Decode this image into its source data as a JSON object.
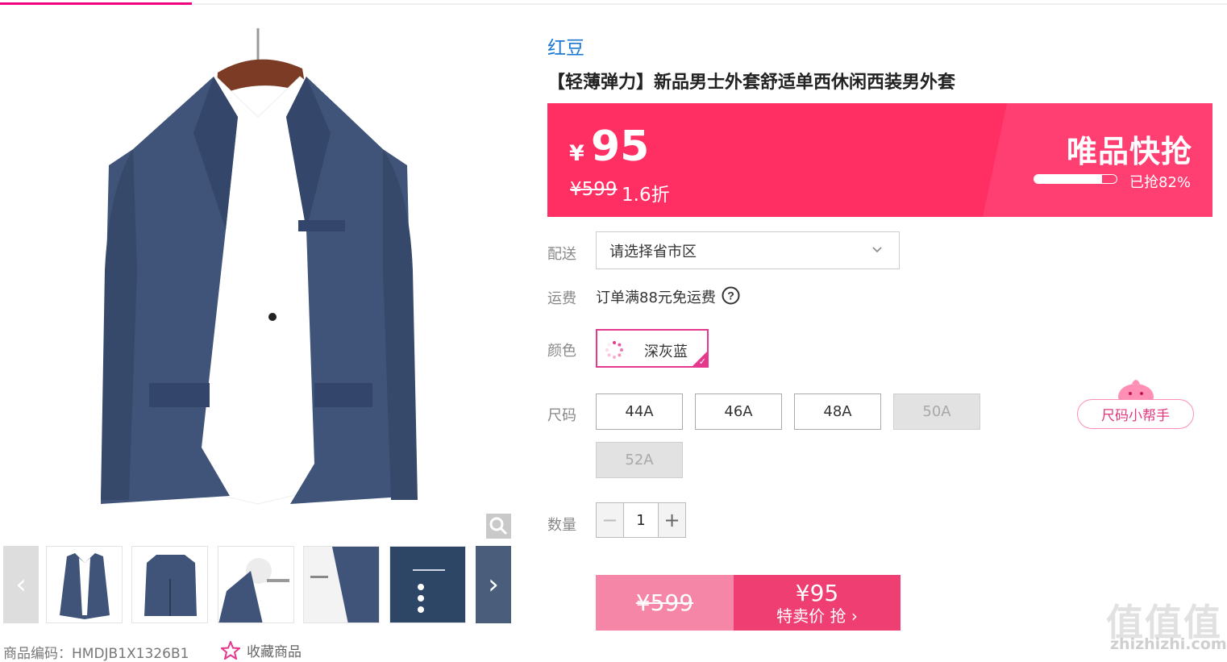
{
  "product": {
    "brand": "红豆",
    "title": "【轻薄弹力】新品男士外套舒适单西休闲西装男外套",
    "sku_label": "商品编码：HMDJB1X1326B1",
    "favorite_label": "收藏商品"
  },
  "price": {
    "currency": "¥",
    "current": "95",
    "original": "¥599",
    "discount": "1.6折",
    "promo_title": "唯品快抢",
    "sold_text": "已抢82%",
    "sold_fraction": 0.82
  },
  "shipping": {
    "label": "配送",
    "placeholder": "请选择省市区",
    "fee_label": "运费",
    "fee_text": "订单满88元免运费"
  },
  "color": {
    "label": "颜色",
    "selected": "深灰蓝"
  },
  "size": {
    "label": "尺码",
    "options": [
      {
        "label": "44A",
        "available": true
      },
      {
        "label": "46A",
        "available": true
      },
      {
        "label": "48A",
        "available": true
      },
      {
        "label": "50A",
        "available": false
      },
      {
        "label": "52A",
        "available": false
      }
    ],
    "helper": "尺码小帮手"
  },
  "quantity": {
    "label": "数量",
    "value": "1",
    "minus": "−",
    "plus": "+"
  },
  "buy": {
    "original": "¥599",
    "price": "¥95",
    "action": "特卖价 抢 ›"
  },
  "watermark": {
    "text": "值值值",
    "url": "zhizhizhi.com"
  },
  "colors": {
    "accent": "#f10180",
    "banner": "#ff2e63",
    "brand_link": "#1a77d2",
    "jacket": "#3f5478"
  }
}
